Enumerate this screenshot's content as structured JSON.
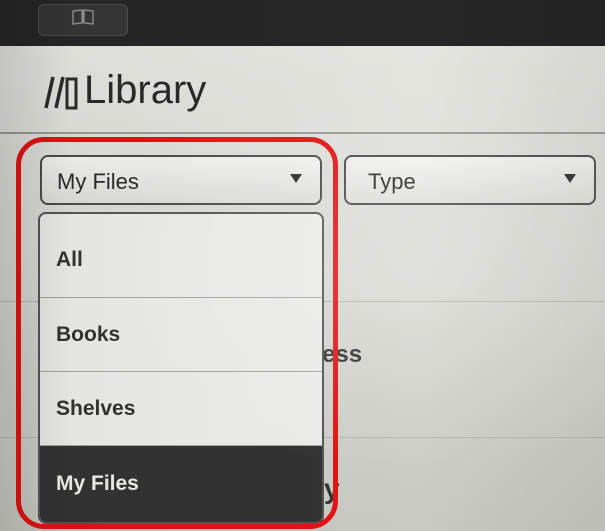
{
  "header": {
    "title": "Library",
    "icon": "library-icon"
  },
  "top_bar": {
    "icon": "book-icon"
  },
  "filters": {
    "source_select": {
      "selected": "My Files"
    },
    "type_select": {
      "selected": "Type"
    }
  },
  "dropdown": {
    "options": [
      {
        "label": "All"
      },
      {
        "label": "Books"
      },
      {
        "label": "Shelves"
      },
      {
        "label": "My Files"
      }
    ],
    "selected": "My Files"
  },
  "background_rows": {
    "fragments": [
      "ess",
      "y"
    ]
  },
  "annotation": {
    "color": "#e31313"
  }
}
